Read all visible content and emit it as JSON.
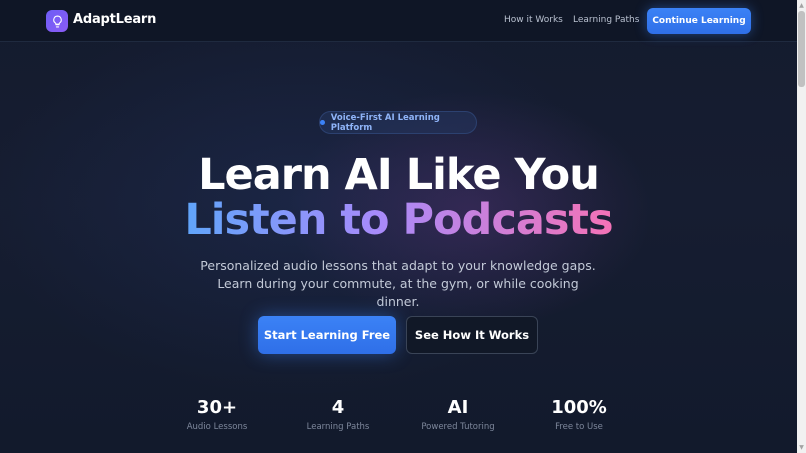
{
  "header": {
    "brand": "AdaptLearn",
    "logo_icon": "lightbulb-icon",
    "nav": [
      {
        "label": "How it Works"
      },
      {
        "label": "Learning Paths"
      }
    ],
    "cta_label": "Continue Learning"
  },
  "hero": {
    "badge": "Voice-First AI Learning Platform",
    "title_line1": "Learn AI Like You",
    "title_line2": "Listen to Podcasts",
    "subtitle": "Personalized audio lessons that adapt to your knowledge gaps. Learn during your commute, at the gym, or while cooking dinner.",
    "primary_button": "Start Learning Free",
    "secondary_button": "See How It Works"
  },
  "stats": [
    {
      "value": "30+",
      "label": "Audio Lessons"
    },
    {
      "value": "4",
      "label": "Learning Paths"
    },
    {
      "value": "AI",
      "label": "Powered Tutoring"
    },
    {
      "value": "100%",
      "label": "Free to Use"
    }
  ],
  "colors": {
    "accent": "#3b82f6",
    "gradient_start": "#60a5fa",
    "gradient_mid": "#a78bfa",
    "gradient_end": "#f472b6",
    "background": "#141b2e"
  }
}
